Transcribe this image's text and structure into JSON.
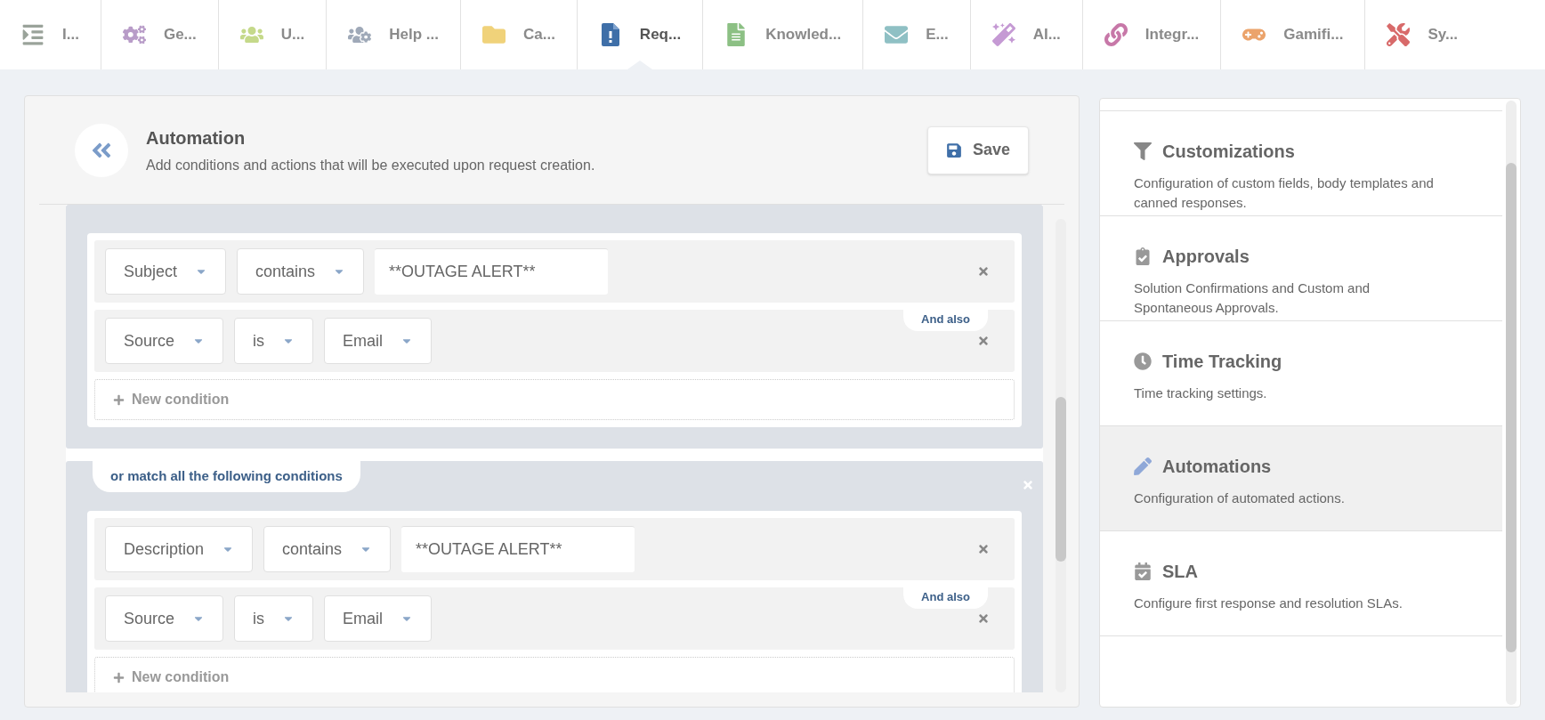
{
  "nav_tabs": [
    {
      "label": "I...",
      "selected": false
    },
    {
      "label": "Ge...",
      "selected": false
    },
    {
      "label": "U...",
      "selected": false
    },
    {
      "label": "Help ...",
      "selected": false
    },
    {
      "label": "Ca...",
      "selected": false
    },
    {
      "label": "Req...",
      "selected": true
    },
    {
      "label": "Knowled...",
      "selected": false
    },
    {
      "label": "E...",
      "selected": false
    },
    {
      "label": "AI...",
      "selected": false
    },
    {
      "label": "Integr...",
      "selected": false
    },
    {
      "label": "Gamifi...",
      "selected": false
    },
    {
      "label": "Sy...",
      "selected": false
    }
  ],
  "page": {
    "title": "Automation",
    "subtitle": "Add conditions and actions that will be executed upon request creation.",
    "save_label": "Save"
  },
  "condition_groups": [
    {
      "conditions": [
        {
          "field": "Subject",
          "operator": "contains",
          "value": "**OUTAGE ALERT**",
          "kind": "text"
        },
        {
          "field": "Source",
          "operator": "is",
          "value": "Email",
          "kind": "dropdown",
          "connector": "And also"
        }
      ],
      "new_condition": "New condition"
    },
    {
      "header": "or match all the following conditions",
      "conditions": [
        {
          "field": "Description",
          "operator": "contains",
          "value": "**OUTAGE ALERT**",
          "kind": "text"
        },
        {
          "field": "Source",
          "operator": "is",
          "value": "Email",
          "kind": "dropdown",
          "connector": "And also"
        }
      ],
      "new_condition": "New condition"
    }
  ],
  "settings_items": [
    {
      "title": "Customizations",
      "description": "Configuration of custom fields, body templates and canned responses.",
      "selected": false
    },
    {
      "title": "Approvals",
      "description": "Solution Confirmations and Custom and Spontaneous Approvals.",
      "selected": false
    },
    {
      "title": "Time Tracking",
      "description": "Time tracking settings.",
      "selected": false
    },
    {
      "title": "Automations",
      "description": "Configuration of automated actions.",
      "selected": true
    },
    {
      "title": "SLA",
      "description": "Configure first response and resolution SLAs.",
      "selected": false
    }
  ]
}
